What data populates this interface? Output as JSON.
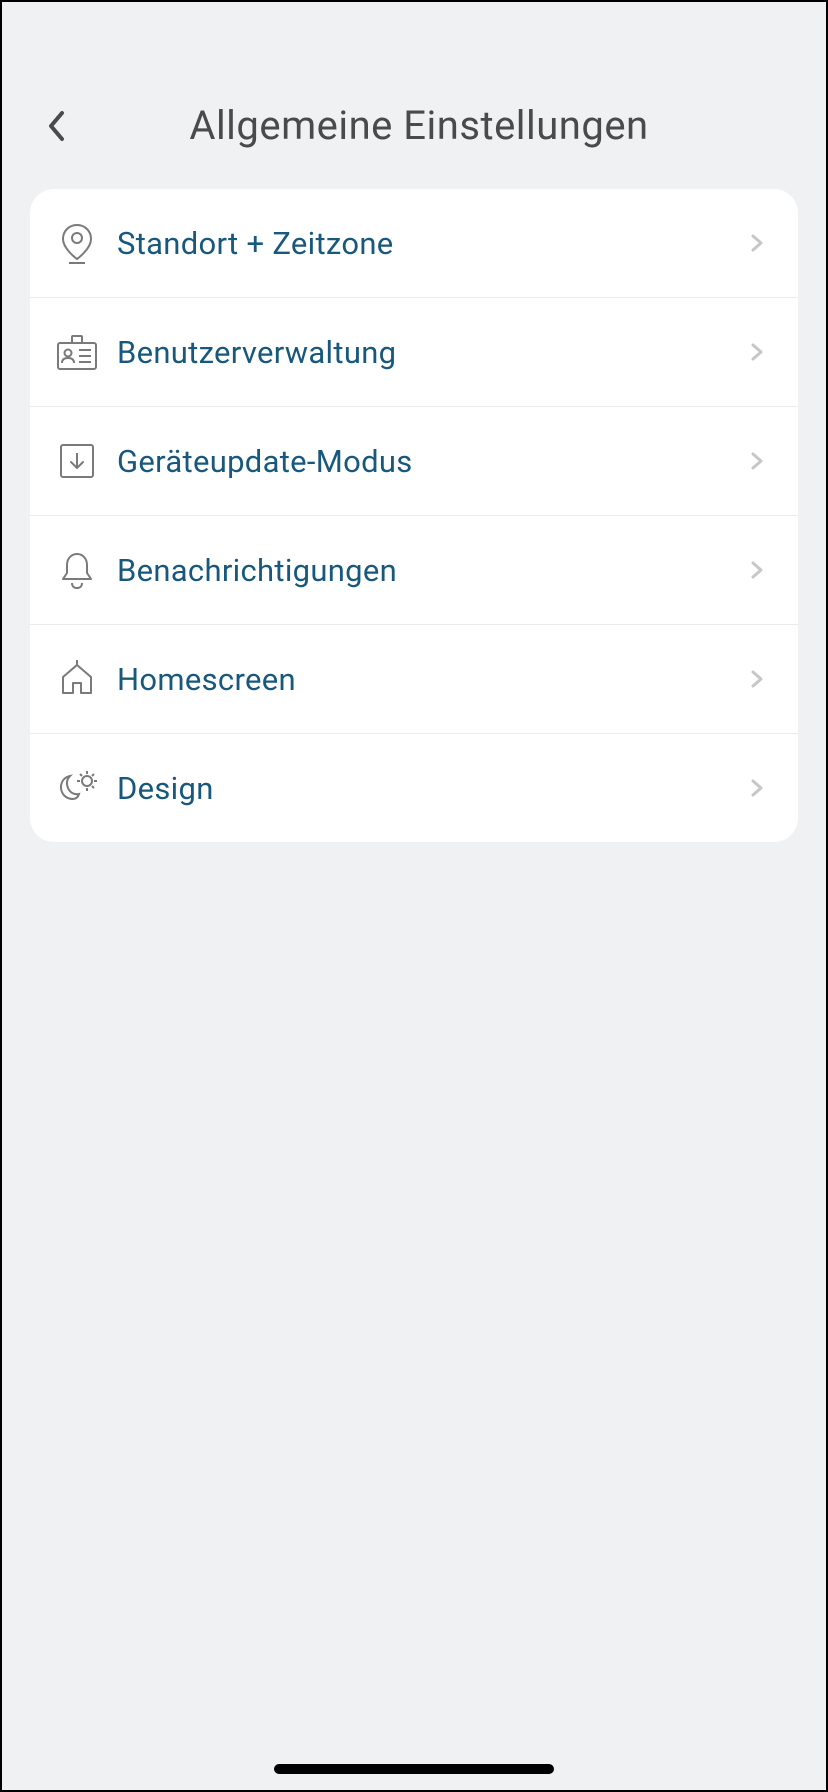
{
  "header": {
    "title": "Allgemeine Einstellungen"
  },
  "settings": {
    "items": [
      {
        "icon": "location-icon",
        "label": "Standort + Zeitzone"
      },
      {
        "icon": "user-management-icon",
        "label": "Benutzerverwaltung"
      },
      {
        "icon": "update-icon",
        "label": "Geräteupdate-Modus"
      },
      {
        "icon": "bell-icon",
        "label": "Benachrichtigungen"
      },
      {
        "icon": "home-icon",
        "label": "Homescreen"
      },
      {
        "icon": "theme-icon",
        "label": "Design"
      }
    ]
  },
  "colors": {
    "accent": "#18587d",
    "iconStroke": "#7a7a7a",
    "background": "#f0f1f3",
    "card": "#ffffff"
  }
}
